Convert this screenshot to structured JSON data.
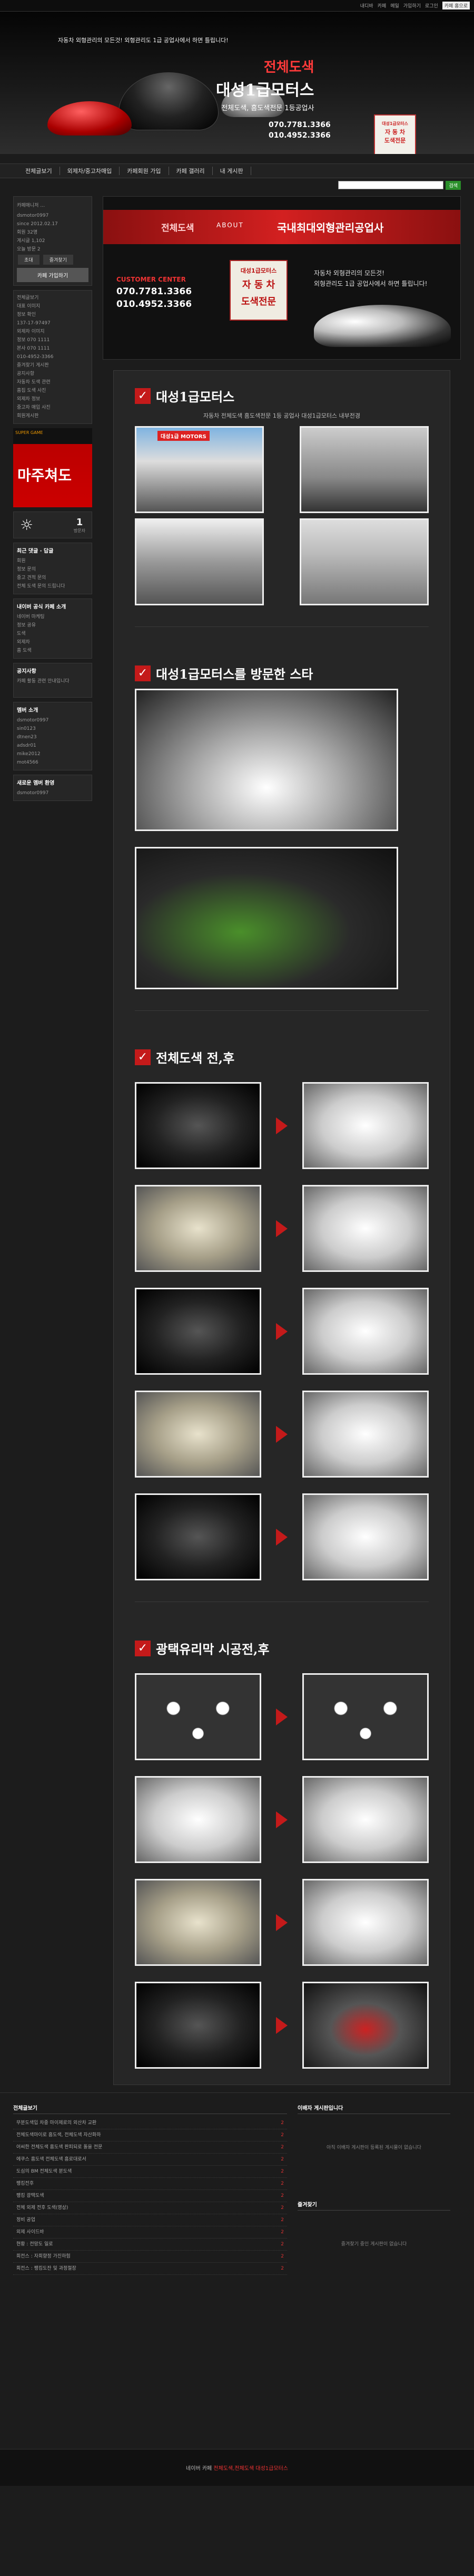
{
  "topbar": {
    "items": [
      "내디바",
      "카페",
      "메일",
      "가입하기",
      "로그인"
    ],
    "select": "카페 홈으로"
  },
  "header": {
    "tagline": "자동차 외형관리의 모든것! 외형관리도 1급 공업사에서 하면 틀립니다!",
    "brand_red": "전체도색",
    "brand_white": "대성1급모터스",
    "brand_sub": "전체도색, 흠도색전문 1등공업사",
    "phone1": "070.7781.3366",
    "phone2": "010.4952.3366",
    "stamp": [
      "대성1급모터스",
      "자 동 차",
      "도색전문"
    ]
  },
  "nav": [
    "전체글보기",
    "외제차/중고차매입",
    "카페회원 가입",
    "카페 갤러리",
    "내 게시판"
  ],
  "search": {
    "button": "검색"
  },
  "left": {
    "manager_label": "카페매니저",
    "manager_name": "dsmotor0997",
    "manager_btn": "1:1 대화",
    "stats": [
      "since 2012.02.17",
      "회원 32명",
      "게시글 1,102",
      "오늘 방문 2"
    ],
    "buttons": [
      "초대",
      "즐겨찾기"
    ],
    "join": "카페 가입하기",
    "menu": [
      "전체글보기",
      "대표 이미지",
      "정보 확인",
      "137-17-97497",
      "외제차 이미지",
      "정보 070 1111",
      "본사 070 1111",
      "010-4952-3366",
      "즐겨찾기 게시판",
      "공지사항",
      "자동차 도색 관련",
      "흠집 도색 사진",
      "외제차 정보",
      "중고차 매입 사진",
      "회원게시판"
    ],
    "ad_top": "SUPER GAME",
    "ad_text": "마주쳐도",
    "visit_sym": "☼",
    "visit_count": "1",
    "visit_label": "방문자",
    "recent_title": "최근 댓글 · 답글",
    "recent": [
      "회원",
      "정보 문의",
      "중고 견적 문의",
      "전체 도색 문의 드립니다"
    ],
    "nb_title": "내이버 공식 카페 소개",
    "nb_items": [
      "네이버 마케팅",
      "정보 공유",
      "도색",
      "외제차",
      "흠 도색"
    ],
    "notice_title": "공지사항",
    "notice_text": "카페 활동 관련 안내입니다",
    "tag_title": "멤버 소개",
    "tag_items": [
      "dsmotor0997",
      "sin0123",
      "dtnen23",
      "adsdr01",
      "mike2012",
      "mot4566"
    ],
    "new_title": "새로운 멤버 환영",
    "new_items": [
      "dsmotor0997"
    ]
  },
  "banner": {
    "red": "전체도색",
    "about": "ABOUT",
    "title": "국내최대외형관리공업사",
    "customer": "CUSTOMER CENTER",
    "phone1": "070.7781.3366",
    "phone2": "010.4952.3366",
    "stamp1": "대성1급모터스",
    "stamp2": "자 동 차",
    "stamp3": "도색전문",
    "desc1": "자동차 외형관리의 모든것!",
    "desc2": "외형관리도 1급 공업사에서 하면 틀립니다!"
  },
  "sections": [
    {
      "title": "대성1급모터스",
      "desc": "자동차 전체도색 흠도색전문 1등 공업사 대성1급모터스 내부전경"
    },
    {
      "title": "대성1급모터스를 방문한 스타",
      "desc": ""
    },
    {
      "title": "전체도색 전,후",
      "desc": ""
    },
    {
      "title": "광택유리막 시공전,후",
      "desc": ""
    }
  ],
  "photo_labels": {
    "logo": "대성1급 MOTORS"
  },
  "bottom": {
    "left_title": "전체글보기",
    "rows": [
      {
        "t": "무분도색입 차중 마이제로의 외산차 교환",
        "n": "2"
      },
      {
        "t": "전체도색마이로 흠도색, 전체도색 자산화하",
        "n": "2"
      },
      {
        "t": "어씨한 전체도색 흠도색 판피되로 돌을 전문",
        "n": "2"
      },
      {
        "t": "에쿠스 흠도색 전체도색 흠로대로서",
        "n": "2"
      },
      {
        "t": "도심의 BM 전체도색 분도색",
        "n": "2"
      },
      {
        "t": "팽킹전후",
        "n": "2"
      },
      {
        "t": "팽킹 광택도색",
        "n": "2"
      },
      {
        "t": "전체 외제 전후 도색(영상)",
        "n": "2"
      },
      {
        "t": "정비 공업",
        "n": "2"
      },
      {
        "t": "외제 사이드바",
        "n": "2"
      },
      {
        "t": "현황 : 전망도 일로",
        "n": "2"
      },
      {
        "t": "회전스 : 자회향정 가진하험",
        "n": "2"
      },
      {
        "t": "회전스 : 팽킹도잔 및 과정절장",
        "n": "2"
      }
    ],
    "right_title1": "이배자 게시판입니다",
    "right_empty1": "아직 이배자 게시판이 등록된 게시물이 없습니다",
    "right_title2": "즐겨찾기",
    "right_empty2": "즐겨찾기 중인 게시판이 없습니다"
  },
  "footer": {
    "prefix": "네이버 카페",
    "brand": "전체도색,전체도색 대성1급모터스"
  }
}
